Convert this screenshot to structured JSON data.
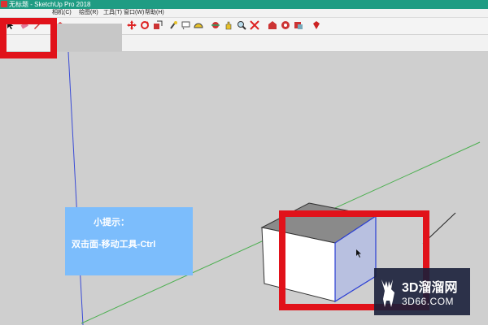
{
  "window": {
    "title": "无标题 - SketchUp Pro 2018"
  },
  "menu": {
    "items": [
      "相机(C)",
      "绘图(R)",
      "工具(T)",
      "窗口(W)",
      "帮助(H)"
    ]
  },
  "toolbar": {
    "icons": [
      "select-icon",
      "eraser-icon",
      "pencil-icon",
      "paint-icon",
      "circle-icon",
      "push-pull-icon",
      "move-icon",
      "rotate-icon",
      "scale-icon",
      "tape-measure-icon",
      "text-icon",
      "protractor-icon",
      "orbit-icon",
      "pan-icon",
      "zoom-icon",
      "zoom-extents-icon",
      "warehouse-icon",
      "extension-icon",
      "layout-icon",
      "ruby-icon"
    ]
  },
  "hint": {
    "title": "小提示：",
    "text": "双击面-移动工具-Ctrl"
  },
  "watermark": {
    "logo": "3D溜溜网",
    "url": "3D66.COM"
  },
  "colors": {
    "titlebar": "#1f9c83",
    "highlight": "#e1121a",
    "hint_bg": "#7cbdfc",
    "viewport_bg": "#cfcfcf",
    "axis_green": "#4caf50",
    "axis_blue": "#3a4bd6"
  }
}
